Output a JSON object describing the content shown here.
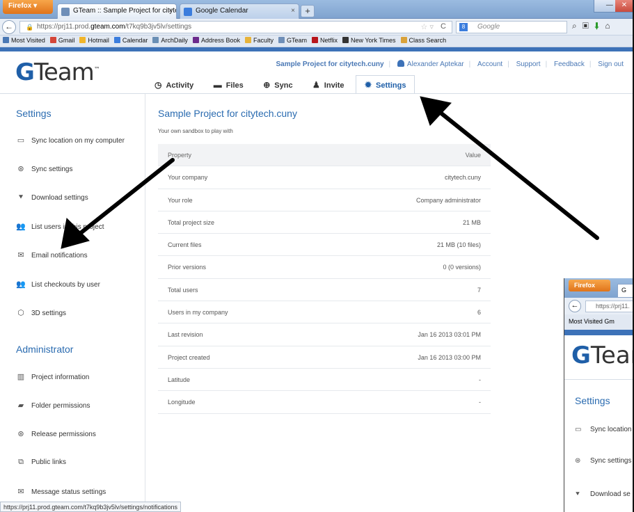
{
  "browser": {
    "ff_label": "Firefox",
    "tabs": [
      {
        "label": "GTeam :: Sample Project for citytech....",
        "close": "×"
      },
      {
        "label": "Google Calendar",
        "close": "×"
      }
    ],
    "newtab": "+",
    "url_prefix": "https://prj11.prod.",
    "url_domain": "gteam.com",
    "url_path": "/t7kq9b3jv5lv/settings",
    "search_placeholder": "Google",
    "bookmarks": [
      {
        "label": "Most Visited",
        "color": "#4a78b5"
      },
      {
        "label": "Gmail",
        "color": "#d44638"
      },
      {
        "label": "Hotmail",
        "color": "#f1b52a"
      },
      {
        "label": "Calendar",
        "color": "#3b7ddd"
      },
      {
        "label": "ArchDaily",
        "color": "#6a8fb5"
      },
      {
        "label": "Address Book",
        "color": "#6b2a8c"
      },
      {
        "label": "Faculty",
        "color": "#e7b33a"
      },
      {
        "label": "GTeam",
        "color": "#6f8fb8"
      },
      {
        "label": "Netflix",
        "color": "#b8161c"
      },
      {
        "label": "New York Times",
        "color": "#333333"
      },
      {
        "label": "Class Search",
        "color": "#d9a23a"
      }
    ],
    "status_url": "https://prj11.prod.gteam.com/t7kq9b3jv5lv/settings/notifications"
  },
  "app": {
    "logo_g": "G",
    "logo_rest": "Team",
    "logo_tm": "™",
    "top_links": {
      "project": "Sample Project for citytech.cuny",
      "user": "Alexander Aptekar",
      "account": "Account",
      "support": "Support",
      "feedback": "Feedback",
      "signout": "Sign out"
    },
    "tabs": [
      {
        "label": "Activity",
        "icon": "◷"
      },
      {
        "label": "Files",
        "icon": "▬"
      },
      {
        "label": "Sync",
        "icon": "⊕"
      },
      {
        "label": "Invite",
        "icon": "♟"
      },
      {
        "label": "Settings",
        "icon": "✹"
      }
    ]
  },
  "sidebar": {
    "settings_heading": "Settings",
    "settings_items": [
      {
        "label": "Sync location on my computer",
        "icon": "▭"
      },
      {
        "label": "Sync settings",
        "icon": "⊛"
      },
      {
        "label": "Download settings",
        "icon": "⯆"
      },
      {
        "label": "List users in this project",
        "icon": "👥"
      },
      {
        "label": "Email notifications",
        "icon": "✉"
      },
      {
        "label": "List checkouts by user",
        "icon": "👥"
      },
      {
        "label": "3D settings",
        "icon": "⬡"
      }
    ],
    "admin_heading": "Administrator",
    "admin_items": [
      {
        "label": "Project information",
        "icon": "▥"
      },
      {
        "label": "Folder permissions",
        "icon": "▰"
      },
      {
        "label": "Release permissions",
        "icon": "⊛"
      },
      {
        "label": "Public links",
        "icon": "⧉"
      },
      {
        "label": "Message status settings",
        "icon": "✉"
      }
    ]
  },
  "main": {
    "title": "Sample Project for citytech.cuny",
    "subtitle": "Your own sandbox to play with",
    "table_headers": {
      "property": "Property",
      "value": "Value"
    },
    "rows": [
      {
        "k": "Your company",
        "v": "citytech.cuny"
      },
      {
        "k": "Your role",
        "v": "Company administrator"
      },
      {
        "k": "Total project size",
        "v": "21 MB"
      },
      {
        "k": "Current files",
        "v": "21 MB (10 files)"
      },
      {
        "k": "Prior versions",
        "v": "0 (0 versions)"
      },
      {
        "k": "Total users",
        "v": "7"
      },
      {
        "k": "Users in my company",
        "v": "6"
      },
      {
        "k": "Last revision",
        "v": "Jan 16 2013 03:01 PM"
      },
      {
        "k": "Project created",
        "v": "Jan 16 2013 03:00 PM"
      },
      {
        "k": "Latitude",
        "v": "-"
      },
      {
        "k": "Longitude",
        "v": "-"
      }
    ]
  },
  "inset": {
    "ff_label": "Firefox",
    "tab_label": "G",
    "url": "https://prj11.",
    "bookmarks": "Most Visited  Gm",
    "logo_g": "G",
    "logo_rest": "Tear",
    "heading": "Settings",
    "items": [
      {
        "label": "Sync location",
        "icon": "▭"
      },
      {
        "label": "Sync settings",
        "icon": "⊛"
      },
      {
        "label": "Download se",
        "icon": "⯆"
      }
    ]
  }
}
